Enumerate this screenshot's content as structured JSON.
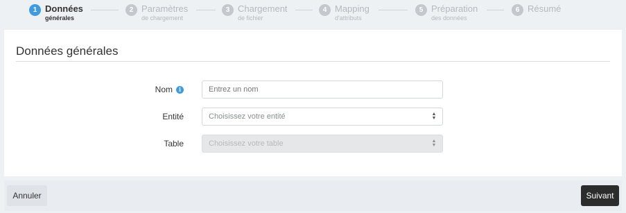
{
  "stepper": {
    "steps": [
      {
        "number": "1",
        "title": "Données",
        "subtitle": "générales",
        "state": "active"
      },
      {
        "number": "2",
        "title": "Paramètres",
        "subtitle": "de chargement",
        "state": "inactive"
      },
      {
        "number": "3",
        "title": "Chargement",
        "subtitle": "de fichier",
        "state": "inactive"
      },
      {
        "number": "4",
        "title": "Mapping",
        "subtitle": "d'attributs",
        "state": "inactive"
      },
      {
        "number": "5",
        "title": "Préparation",
        "subtitle": "des données",
        "state": "inactive"
      },
      {
        "number": "6",
        "title": "Résumé",
        "subtitle": "",
        "state": "inactive"
      }
    ]
  },
  "card": {
    "title": "Données générales"
  },
  "form": {
    "nom": {
      "label": "Nom",
      "placeholder": "Entrez un nom"
    },
    "entite": {
      "label": "Entité",
      "placeholder": "Choisissez votre entité"
    },
    "table": {
      "label": "Table",
      "placeholder": "Choisissez votre table",
      "disabled": true
    }
  },
  "footer": {
    "cancel_label": "Annuler",
    "next_label": "Suivant"
  },
  "colors": {
    "accent": "#3d9be0",
    "primary_button": "#2c2c2c",
    "background": "#eef1f4"
  }
}
